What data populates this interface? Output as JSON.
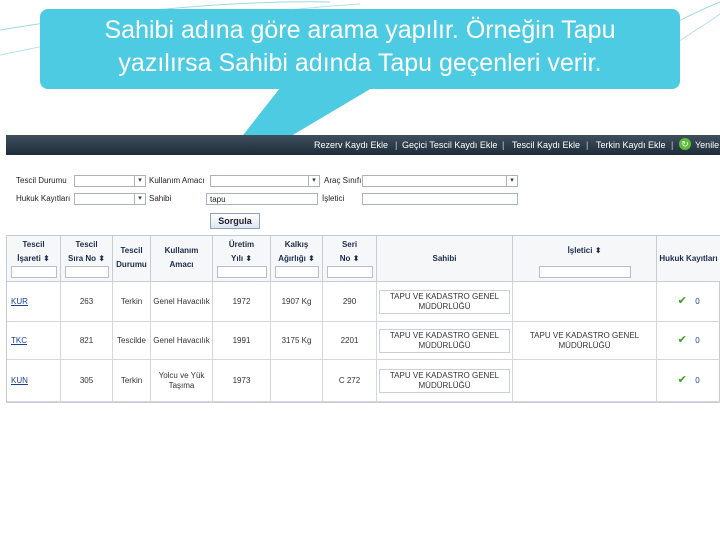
{
  "callout": {
    "line1": "Sahibi adına göre arama yapılır. Örneğin Tapu",
    "line2": "yazılırsa Sahibi adında Tapu geçenleri verir.",
    "color": "#4dcbe2"
  },
  "navbar": {
    "items": [
      "Rezerv Kaydı Ekle",
      "Geçici Tescil Kaydı Ekle",
      "Tescil Kaydı Ekle",
      "Terkin Kaydı Ekle",
      "Yenile"
    ],
    "separator": "|"
  },
  "filters": {
    "tescil_durumu_label": "Tescil Durumu",
    "tescil_durumu_value": "",
    "kullanim_amaci_label": "Kullanım Amacı",
    "kullanim_amaci_value": "",
    "arac_sinifi_label": "Araç Sınıfı",
    "arac_sinifi_value": "",
    "hukuk_kayitlari_label": "Hukuk Kayıtları",
    "hukuk_kayitlari_value": "",
    "sahibi_label": "Sahibi",
    "sahibi_value": "tapu",
    "isletici_label": "İşletici",
    "isletici_value": "",
    "sorgula_label": "Sorgula"
  },
  "table": {
    "headers": [
      {
        "l1": "Tescil",
        "l2": "İşareti ⬍"
      },
      {
        "l1": "Tescil",
        "l2": "Sıra No ⬍"
      },
      {
        "l1": "Tescil",
        "l2": "Durumu"
      },
      {
        "l1": "Kullanım",
        "l2": "Amacı"
      },
      {
        "l1": "Üretim",
        "l2": "Yılı ⬍"
      },
      {
        "l1": "Kalkış",
        "l2": "Ağırlığı ⬍"
      },
      {
        "l1": "Seri",
        "l2": "No ⬍"
      },
      {
        "l1": "Sahibi",
        "l2": ""
      },
      {
        "l1": "İşletici ⬍",
        "l2": ""
      },
      {
        "l1": "Hukuk Kayıtları",
        "l2": ""
      }
    ],
    "rows": [
      {
        "isaret": "KUR",
        "sira": "263",
        "durum": "Terkin",
        "amac": "Genel Havacılık",
        "yil": "1972",
        "agirlik": "1907 Kg",
        "seri": "290",
        "sahibi": "TAPU VE KADASTRO GENEL MÜDÜRLÜĞÜ",
        "isletici": "",
        "hukuk": "0"
      },
      {
        "isaret": "TKC",
        "sira": "821",
        "durum": "Tescilde",
        "amac": "Genel Havacılık",
        "yil": "1991",
        "agirlik": "3175 Kg",
        "seri": "2201",
        "sahibi": "TAPU VE KADASTRO GENEL MÜDÜRLÜĞÜ",
        "isletici": "TAPU VE KADASTRO GENEL MÜDÜRLÜĞÜ",
        "hukuk": "0"
      },
      {
        "isaret": "KUN",
        "sira": "305",
        "durum": "Terkin",
        "amac": "Yolcu ve Yük Taşıma",
        "yil": "1973",
        "agirlik": "",
        "seri": "C 272",
        "sahibi": "TAPU VE KADASTRO GENEL MÜDÜRLÜĞÜ",
        "isletici": "",
        "hukuk": "0"
      }
    ]
  }
}
